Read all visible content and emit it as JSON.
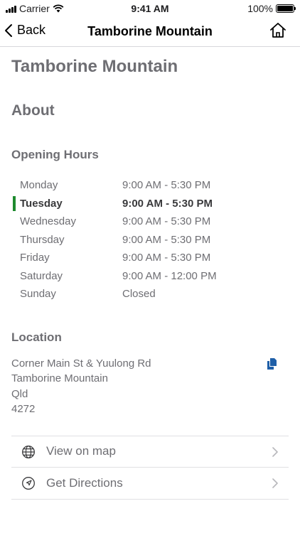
{
  "status_bar": {
    "carrier": "Carrier",
    "time": "9:41 AM",
    "battery": "100%",
    "battery_level": 1.0
  },
  "nav": {
    "back_label": "Back",
    "title": "Tamborine Mountain",
    "home_icon": "home-icon"
  },
  "page": {
    "title": "Tamborine Mountain",
    "about_heading": "About",
    "hours_heading": "Opening Hours",
    "hours": [
      {
        "day": "Monday",
        "time": "9:00 AM - 5:30 PM",
        "today": false
      },
      {
        "day": "Tuesday",
        "time": "9:00 AM - 5:30 PM",
        "today": true
      },
      {
        "day": "Wednesday",
        "time": "9:00 AM - 5:30 PM",
        "today": false
      },
      {
        "day": "Thursday",
        "time": "9:00 AM - 5:30 PM",
        "today": false
      },
      {
        "day": "Friday",
        "time": "9:00 AM - 5:30 PM",
        "today": false
      },
      {
        "day": "Saturday",
        "time": "9:00 AM - 12:00 PM",
        "today": false
      },
      {
        "day": "Sunday",
        "time": "Closed",
        "today": false
      }
    ],
    "location_heading": "Location",
    "address": {
      "line1": "Corner Main St & Yuulong Rd",
      "line2": "Tamborine Mountain",
      "line3": "Qld",
      "line4": "4272"
    },
    "copy_icon": "copy-icon",
    "links": [
      {
        "label": "View on map",
        "icon": "globe-icon"
      },
      {
        "label": "Get Directions",
        "icon": "navigation-arrow-icon"
      }
    ]
  },
  "colors": {
    "today_marker": "#1e8a2e",
    "copy_icon": "#1f5fa8",
    "heading_gray": "#6e6e73"
  }
}
